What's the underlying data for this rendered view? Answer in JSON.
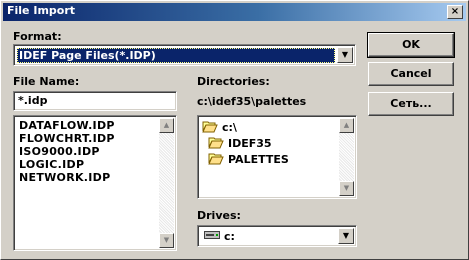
{
  "window": {
    "title": "File Import",
    "close_glyph": "×"
  },
  "format": {
    "label": "Format:",
    "selected": "IDEF Page Files(*.IDP)",
    "dropdown_glyph": "▼"
  },
  "buttons": {
    "ok": "OK",
    "cancel": "Cancel",
    "network": "Сеть..."
  },
  "file_name": {
    "label": "File Name:",
    "value": "*.idp",
    "files": [
      "DATAFLOW.IDP",
      "FLOWCHRT.IDP",
      "ISO9000.IDP",
      "LOGIC.IDP",
      "NETWORK.IDP"
    ]
  },
  "directories": {
    "label": "Directories:",
    "current_path": "c:\\idef35\\palettes",
    "tree": [
      {
        "name": "c:\\",
        "state": "open"
      },
      {
        "name": "IDEF35",
        "state": "open"
      },
      {
        "name": "PALETTES",
        "state": "open-selected"
      }
    ]
  },
  "drives": {
    "label": "Drives:",
    "selected": "c:",
    "icon": "drive-icon",
    "dropdown_glyph": "▼"
  },
  "scroll": {
    "up_glyph": "▲",
    "down_glyph": "▼"
  }
}
